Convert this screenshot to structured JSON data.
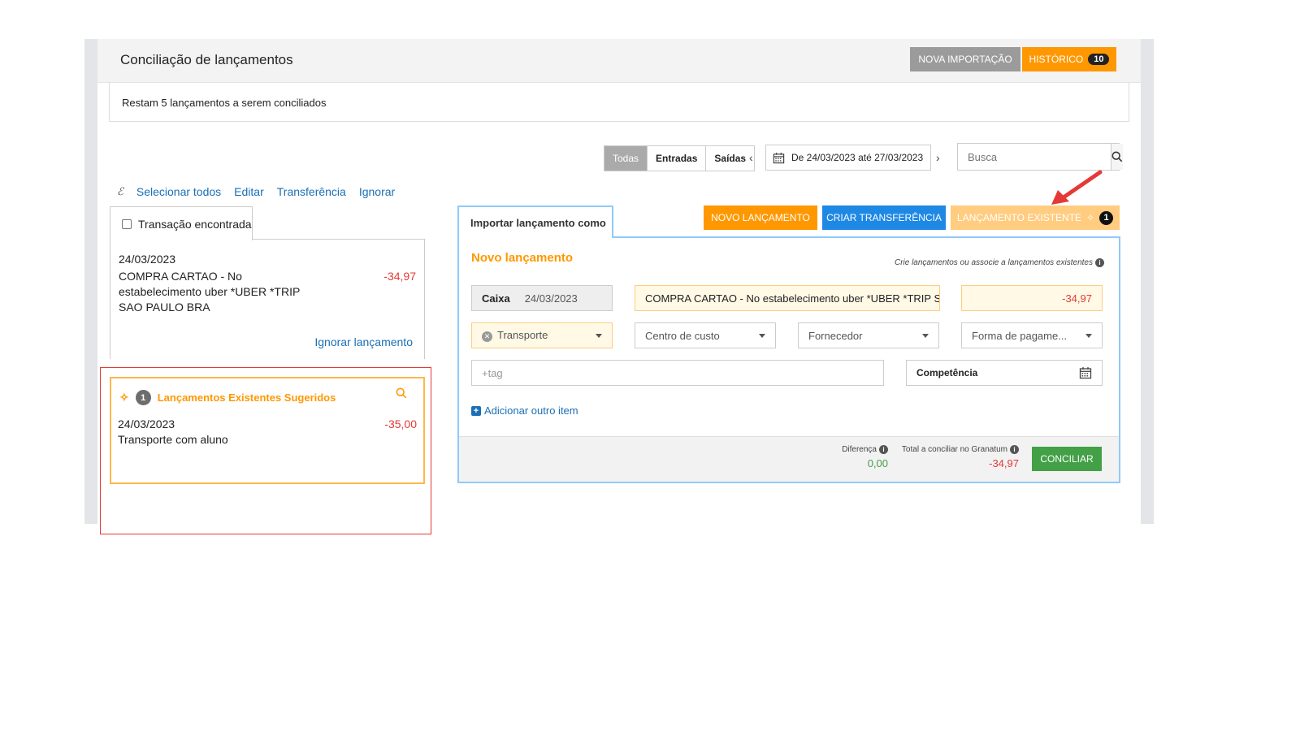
{
  "header": {
    "title": "Conciliação de lançamentos",
    "nova_importacao": "NOVA IMPORTAÇÃO",
    "historico": "HISTÓRICO",
    "historico_count": "10"
  },
  "info": {
    "remaining": "Restam 5 lançamentos a serem conciliados"
  },
  "filters": {
    "tabs": [
      "Todas",
      "Entradas",
      "Saídas"
    ],
    "active": "Todas",
    "date_range": "De 24/03/2023 até 27/03/2023",
    "search_placeholder": "Busca"
  },
  "actions": {
    "select_all": "Selecionar todos",
    "edit": "Editar",
    "transfer": "Transferência",
    "ignore": "Ignorar"
  },
  "transaction": {
    "tab_label": "Transação encontrada",
    "date": "24/03/2023",
    "description": "COMPRA CARTAO - No estabelecimento uber *UBER *TRIP SAO PAULO BRA",
    "amount": "-34,97",
    "ignore_link": "Ignorar lançamento"
  },
  "suggested": {
    "count": "1",
    "title": "Lançamentos Existentes Sugeridos",
    "date": "24/03/2023",
    "description": "Transporte com aluno",
    "amount": "-35,00"
  },
  "import_panel": {
    "tab_label": "Importar lançamento como",
    "novo_lancamento_btn": "NOVO LANÇAMENTO",
    "criar_transferencia_btn": "CRIAR TRANSFERÊNCIA",
    "lancamento_existente_btn": "LANÇAMENTO EXISTENTE",
    "lancamento_existente_count": "1",
    "section_title": "Novo lançamento",
    "hint": "Crie lançamentos ou associe a lançamentos existentes",
    "account": "Caixa",
    "date": "24/03/2023",
    "description": "COMPRA CARTAO - No estabelecimento uber *UBER *TRIP SAO PAULO BRA",
    "amount": "-34,97",
    "category": "Transporte",
    "cost_center_placeholder": "Centro de custo",
    "supplier_placeholder": "Fornecedor",
    "payment_placeholder": "Forma de pagame...",
    "tag_placeholder": "+tag",
    "competencia": "Competência",
    "add_item": "Adicionar outro item"
  },
  "footer": {
    "diferenca_label": "Diferença",
    "diferenca_value": "0,00",
    "total_label": "Total a conciliar no Granatum",
    "total_value": "-34,97",
    "conciliar": "CONCILIAR"
  },
  "colors": {
    "accent_orange": "#ff9800",
    "blue": "#1e88e5",
    "green": "#43a047",
    "red": "#e53935"
  }
}
